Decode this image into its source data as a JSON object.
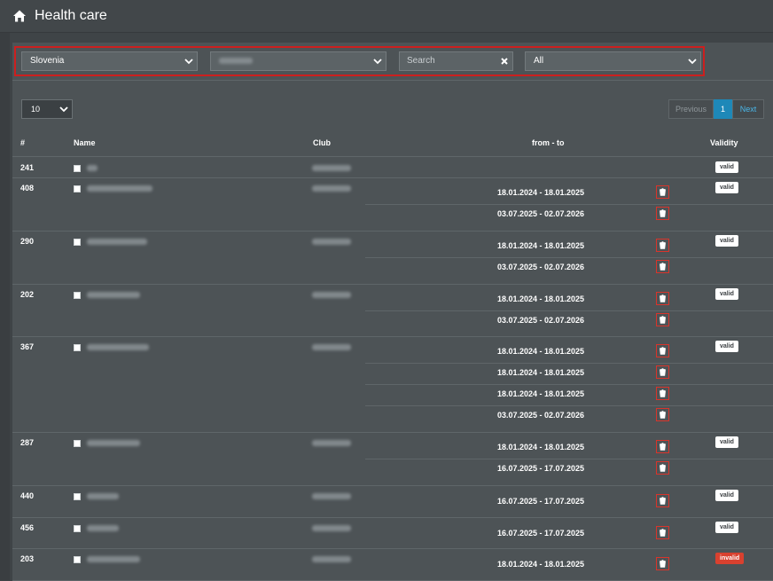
{
  "header": {
    "title": "Health care",
    "icon": "home-icon"
  },
  "filters": {
    "country": "Slovenia",
    "club": "",
    "search_placeholder": "Search",
    "validity_filter": "All"
  },
  "table_controls": {
    "page_length": "10",
    "pager": {
      "previous": "Previous",
      "current": "1",
      "next": "Next"
    }
  },
  "columns": {
    "id": "#",
    "name": "Name",
    "club": "Club",
    "from_to": "from - to",
    "validity": "Validity"
  },
  "rows": [
    {
      "id": "241",
      "dates": [],
      "validity": "valid"
    },
    {
      "id": "408",
      "dates": [
        "18.01.2024 - 18.01.2025",
        "03.07.2025 - 02.07.2026"
      ],
      "validity": "valid"
    },
    {
      "id": "290",
      "dates": [
        "18.01.2024 - 18.01.2025",
        "03.07.2025 - 02.07.2026"
      ],
      "validity": "valid"
    },
    {
      "id": "202",
      "dates": [
        "18.01.2024 - 18.01.2025",
        "03.07.2025 - 02.07.2026"
      ],
      "validity": "valid"
    },
    {
      "id": "367",
      "dates": [
        "18.01.2024 - 18.01.2025",
        "18.01.2024 - 18.01.2025",
        "18.01.2024 - 18.01.2025",
        "03.07.2025 - 02.07.2026"
      ],
      "validity": "valid"
    },
    {
      "id": "287",
      "dates": [
        "18.01.2024 - 18.01.2025",
        "16.07.2025 - 17.07.2025"
      ],
      "validity": "valid"
    },
    {
      "id": "440",
      "dates": [
        "16.07.2025 - 17.07.2025"
      ],
      "validity": "valid"
    },
    {
      "id": "456",
      "dates": [
        "16.07.2025 - 17.07.2025"
      ],
      "validity": "valid"
    },
    {
      "id": "203",
      "dates": [
        "18.01.2024 - 18.01.2025"
      ],
      "validity": "invalid"
    }
  ],
  "colors": {
    "accent": "#1e88b8",
    "danger": "#d9342b",
    "panel": "#4d5356",
    "background": "#3f4447"
  }
}
